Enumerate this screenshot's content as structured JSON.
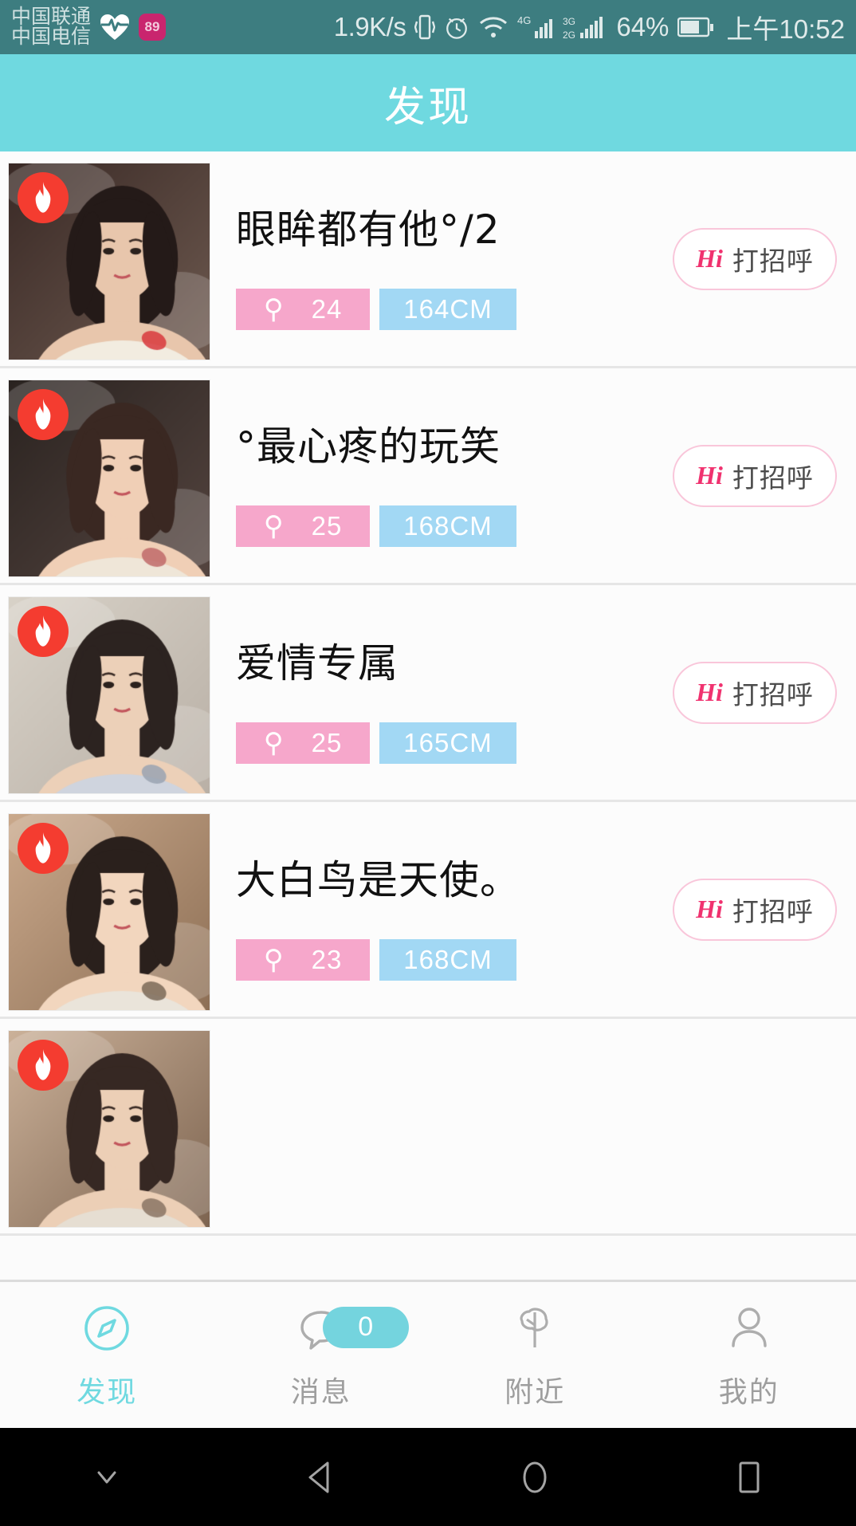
{
  "status_bar": {
    "carriers": [
      "中国联通",
      "中国电信"
    ],
    "icons": [
      "heart-pulse-icon",
      "app-badge-icon"
    ],
    "app_badge_text": "89",
    "network_speed": "1.9K/s",
    "indicator_icons": [
      "vibrate-icon",
      "alarm-icon",
      "wifi-icon",
      "signal-4g-icon",
      "signal-3g-2g-icon"
    ],
    "signal_4g_label": "4G",
    "signal_3g_label": "3G",
    "signal_2g_label": "2G",
    "battery_percent": "64%",
    "time": "上午10:52",
    "bg_color": "#3d7d80"
  },
  "header": {
    "title": "发现",
    "bg_color": "#6fd9e0",
    "text_color": "#ffffff"
  },
  "list": {
    "hot_badge_icon": "flame-icon",
    "hot_badge_color": "#f43c30",
    "age_tag_color": "#f6a7cb",
    "height_tag_color": "#a2d8f4",
    "gender_symbol": "⚲",
    "items": [
      {
        "name": "眼眸都有他°/2",
        "age": "24",
        "height": "164CM",
        "hi_label": "Hi",
        "greet_label": "打招呼",
        "photo": "woman-selfie-white-top"
      },
      {
        "name": "°最心疼的玩笑",
        "age": "25",
        "height": "168CM",
        "hi_label": "Hi",
        "greet_label": "打招呼",
        "photo": "woman-hand-over-eye"
      },
      {
        "name": "爱情专属",
        "age": "25",
        "height": "165CM",
        "hi_label": "Hi",
        "greet_label": "打招呼",
        "photo": "woman-fur-collar"
      },
      {
        "name": "大白鸟是天使。",
        "age": "23",
        "height": "168CM",
        "hi_label": "Hi",
        "greet_label": "打招呼",
        "photo": "woman-hat-heart-hands"
      },
      {
        "name": "",
        "age": "",
        "height": "",
        "hi_label": "",
        "greet_label": "",
        "photo": "woman-partial-cutoff"
      }
    ]
  },
  "tabbar": {
    "active_color": "#6fd9e0",
    "inactive_color": "#9e9e9e",
    "tabs": [
      {
        "label": "发现",
        "icon": "compass-icon",
        "active": true,
        "badge": null
      },
      {
        "label": "消息",
        "icon": "chat-bubble-icon",
        "active": false,
        "badge": "0"
      },
      {
        "label": "附近",
        "icon": "tree-icon",
        "active": false,
        "badge": null
      },
      {
        "label": "我的",
        "icon": "person-icon",
        "active": false,
        "badge": null
      }
    ]
  },
  "android_nav": {
    "buttons": [
      {
        "name": "hide-navbar",
        "icon": "chevron-down-icon"
      },
      {
        "name": "back",
        "icon": "triangle-back-icon"
      },
      {
        "name": "home",
        "icon": "circle-home-icon"
      },
      {
        "name": "recents",
        "icon": "square-recents-icon"
      }
    ]
  }
}
